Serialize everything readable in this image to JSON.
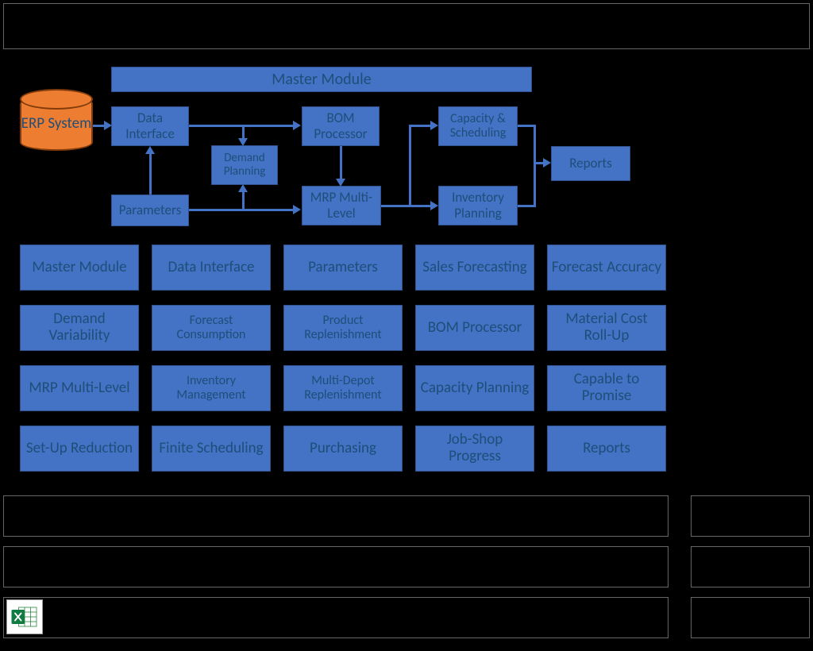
{
  "erp_label": "ERP System",
  "diagram": {
    "master_module": "Master Module",
    "data_interface": "Data Interface",
    "demand_planning": "Demand Planning",
    "bom_processor": "BOM Processor",
    "mrp_multilevel": "MRP Multi-Level",
    "capacity_scheduling": "Capacity & Scheduling",
    "inventory_planning": "Inventory Planning",
    "reports": "Reports",
    "parameters": "Parameters"
  },
  "modules": [
    "Master Module",
    "Data Interface",
    "Parameters",
    "Sales Forecasting",
    "Forecast Accuracy",
    "Demand Variability",
    "Forecast Consumption",
    "Product Replenishment",
    "BOM Processor",
    "Material Cost Roll-Up",
    "MRP Multi-Level",
    "Inventory Management",
    "Multi-Depot Replenishment",
    "Capacity Planning",
    "Capable to Promise",
    "Set-Up Reduction",
    "Finite Scheduling",
    "Purchasing",
    "Job-Shop Progress",
    "Reports"
  ],
  "icon_name": "excel-icon"
}
